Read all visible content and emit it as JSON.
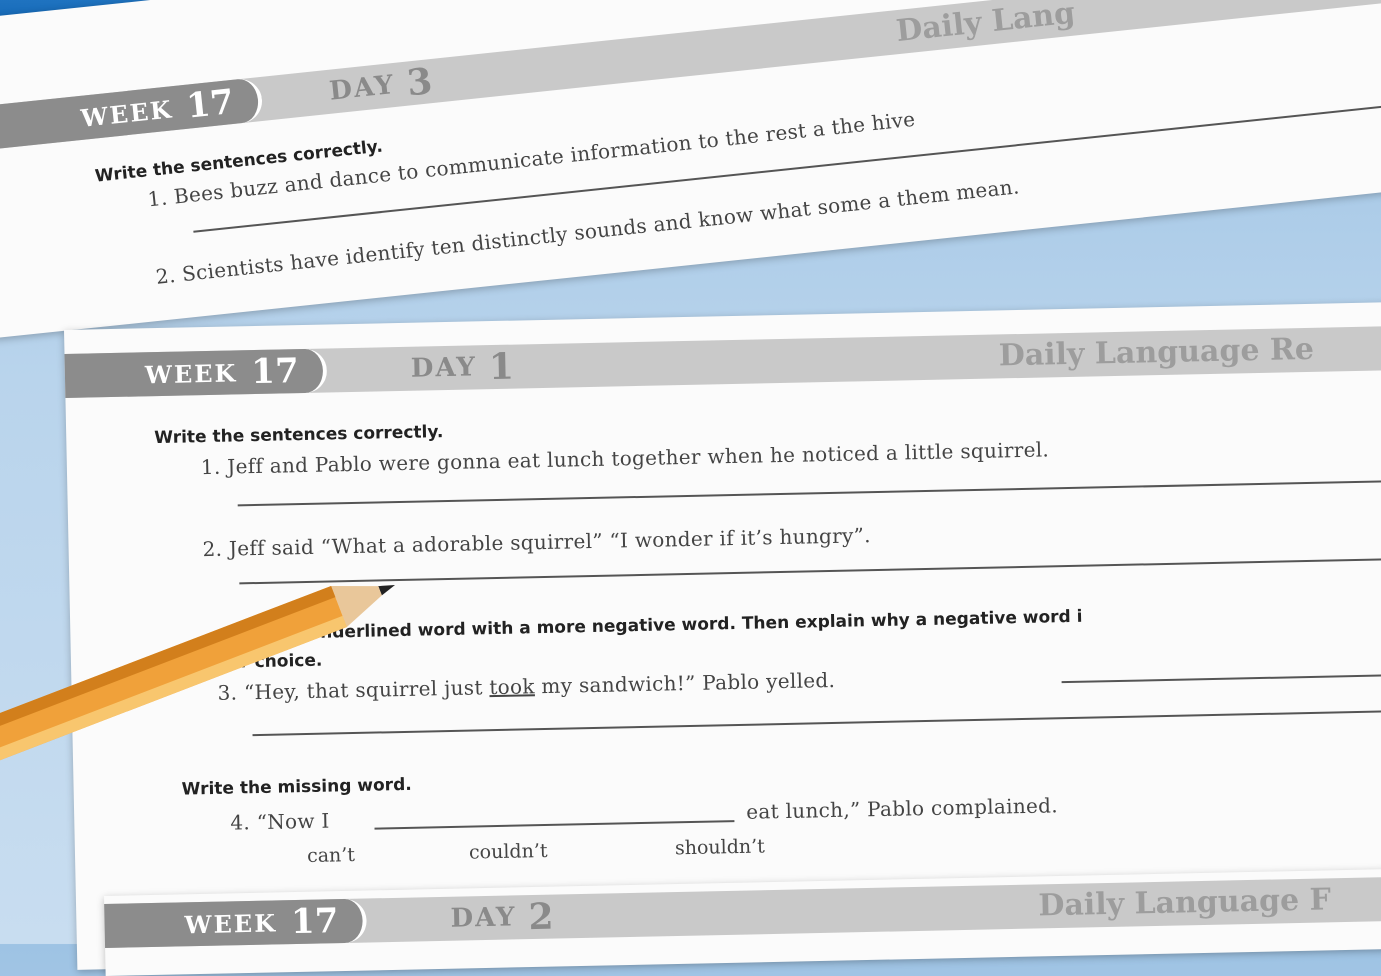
{
  "sheet_back": {
    "week_label": "WEEK",
    "week_number": "17",
    "day_label": "DAY",
    "day_number": "3",
    "title": "Daily Lang",
    "instruction": "Write the sentences correctly.",
    "items": [
      "1. Bees buzz and dance to communicate information to the rest a the hive",
      "2. Scientists have identify ten distinctly sounds and know what some a them mean."
    ]
  },
  "sheet_front": {
    "week_label": "WEEK",
    "week_number": "17",
    "day_label": "DAY",
    "day_number": "1",
    "title": "Daily Language Re",
    "section1_instruction": "Write the sentences correctly.",
    "item1": "1. Jeff and Pablo were gonna eat lunch together when he noticed a little squirrel.",
    "item2": "2. Jeff said “What a adorable squirrel” “I wonder if it’s hungry”.",
    "section2_instruction_line1": "the underlined word with a more negative word. Then explain why a negative word i",
    "section2_instruction_line2": "etter choice.",
    "item3_before": "3. “Hey, that squirrel just ",
    "item3_underlined": "took",
    "item3_after": " my sandwich!” Pablo yelled.",
    "section3_instruction": "Write the missing word.",
    "item4_before": "4. “Now I",
    "item4_after": "eat lunch,” Pablo complained.",
    "choices": [
      "can’t",
      "couldn’t",
      "shouldn’t"
    ]
  },
  "sheet_bottom": {
    "week_label": "WEEK",
    "week_number": "17",
    "day_label": "DAY",
    "day_number": "2",
    "title": "Daily Language F"
  },
  "colors": {
    "top_bar": "#0b5fae",
    "background": "#b9d4ec",
    "pencil": "#f0a13a"
  }
}
